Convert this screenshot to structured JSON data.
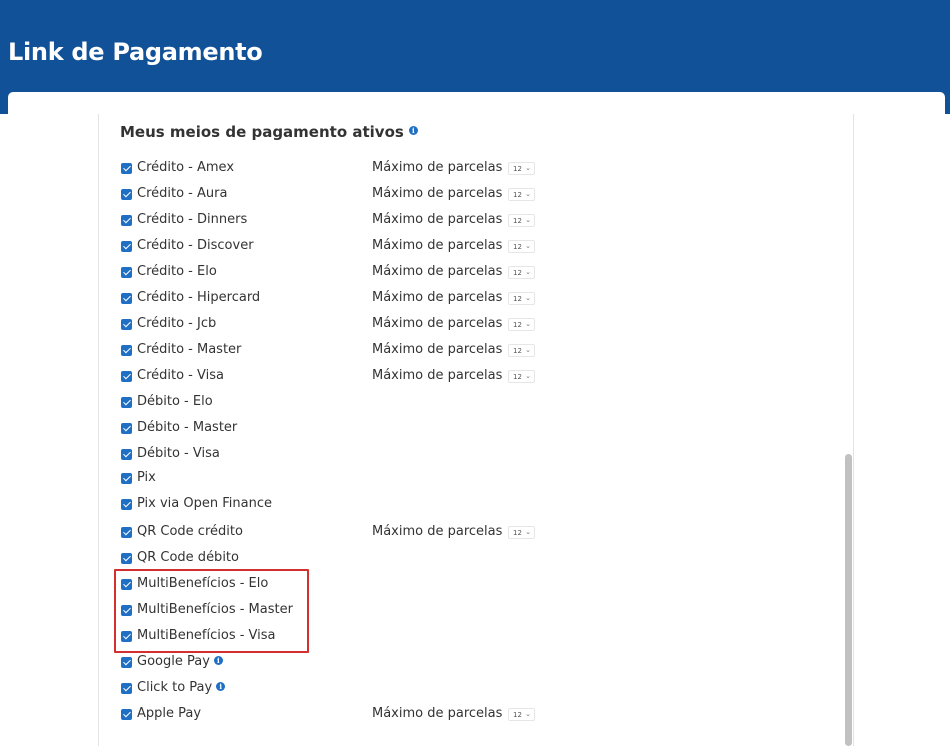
{
  "header": {
    "title": "Link de Pagamento"
  },
  "section": {
    "title": "Meus meios de pagamento ativos"
  },
  "installments_label": "Máximo de parcelas",
  "payment_methods": [
    {
      "label": "Crédito - Amex",
      "checked": true,
      "installments": "12"
    },
    {
      "label": "Crédito - Aura",
      "checked": true,
      "installments": "12"
    },
    {
      "label": "Crédito - Dinners",
      "checked": true,
      "installments": "12"
    },
    {
      "label": "Crédito - Discover",
      "checked": true,
      "installments": "12"
    },
    {
      "label": "Crédito - Elo",
      "checked": true,
      "installments": "12"
    },
    {
      "label": "Crédito - Hipercard",
      "checked": true,
      "installments": "12"
    },
    {
      "label": "Crédito - Jcb",
      "checked": true,
      "installments": "12"
    },
    {
      "label": "Crédito - Master",
      "checked": true,
      "installments": "12"
    },
    {
      "label": "Crédito - Visa",
      "checked": true,
      "installments": "12"
    },
    {
      "label": "Débito - Elo",
      "checked": true
    },
    {
      "label": "Débito - Master",
      "checked": true
    },
    {
      "label": "Débito - Visa",
      "checked": true
    },
    {
      "label": "Pix",
      "checked": true
    },
    {
      "label": "Pix via Open Finance",
      "checked": true
    },
    {
      "label": "QR Code crédito",
      "checked": true,
      "installments": "12"
    },
    {
      "label": "QR Code débito",
      "checked": true
    },
    {
      "label": "MultiBenefícios - Elo",
      "checked": true
    },
    {
      "label": "MultiBenefícios - Master",
      "checked": true
    },
    {
      "label": "MultiBenefícios - Visa",
      "checked": true
    },
    {
      "label": "Google Pay",
      "checked": true,
      "info": true
    },
    {
      "label": "Click to Pay",
      "checked": true,
      "info": true
    },
    {
      "label": "Apple Pay",
      "checked": true,
      "installments": "12"
    }
  ],
  "colors": {
    "header": "#115197",
    "accent": "#1f6fc5",
    "highlight": "#d32f2f"
  },
  "icons": {
    "info": "info-icon",
    "chevron": "chevron-down-icon",
    "check": "checkbox-checked-icon"
  }
}
